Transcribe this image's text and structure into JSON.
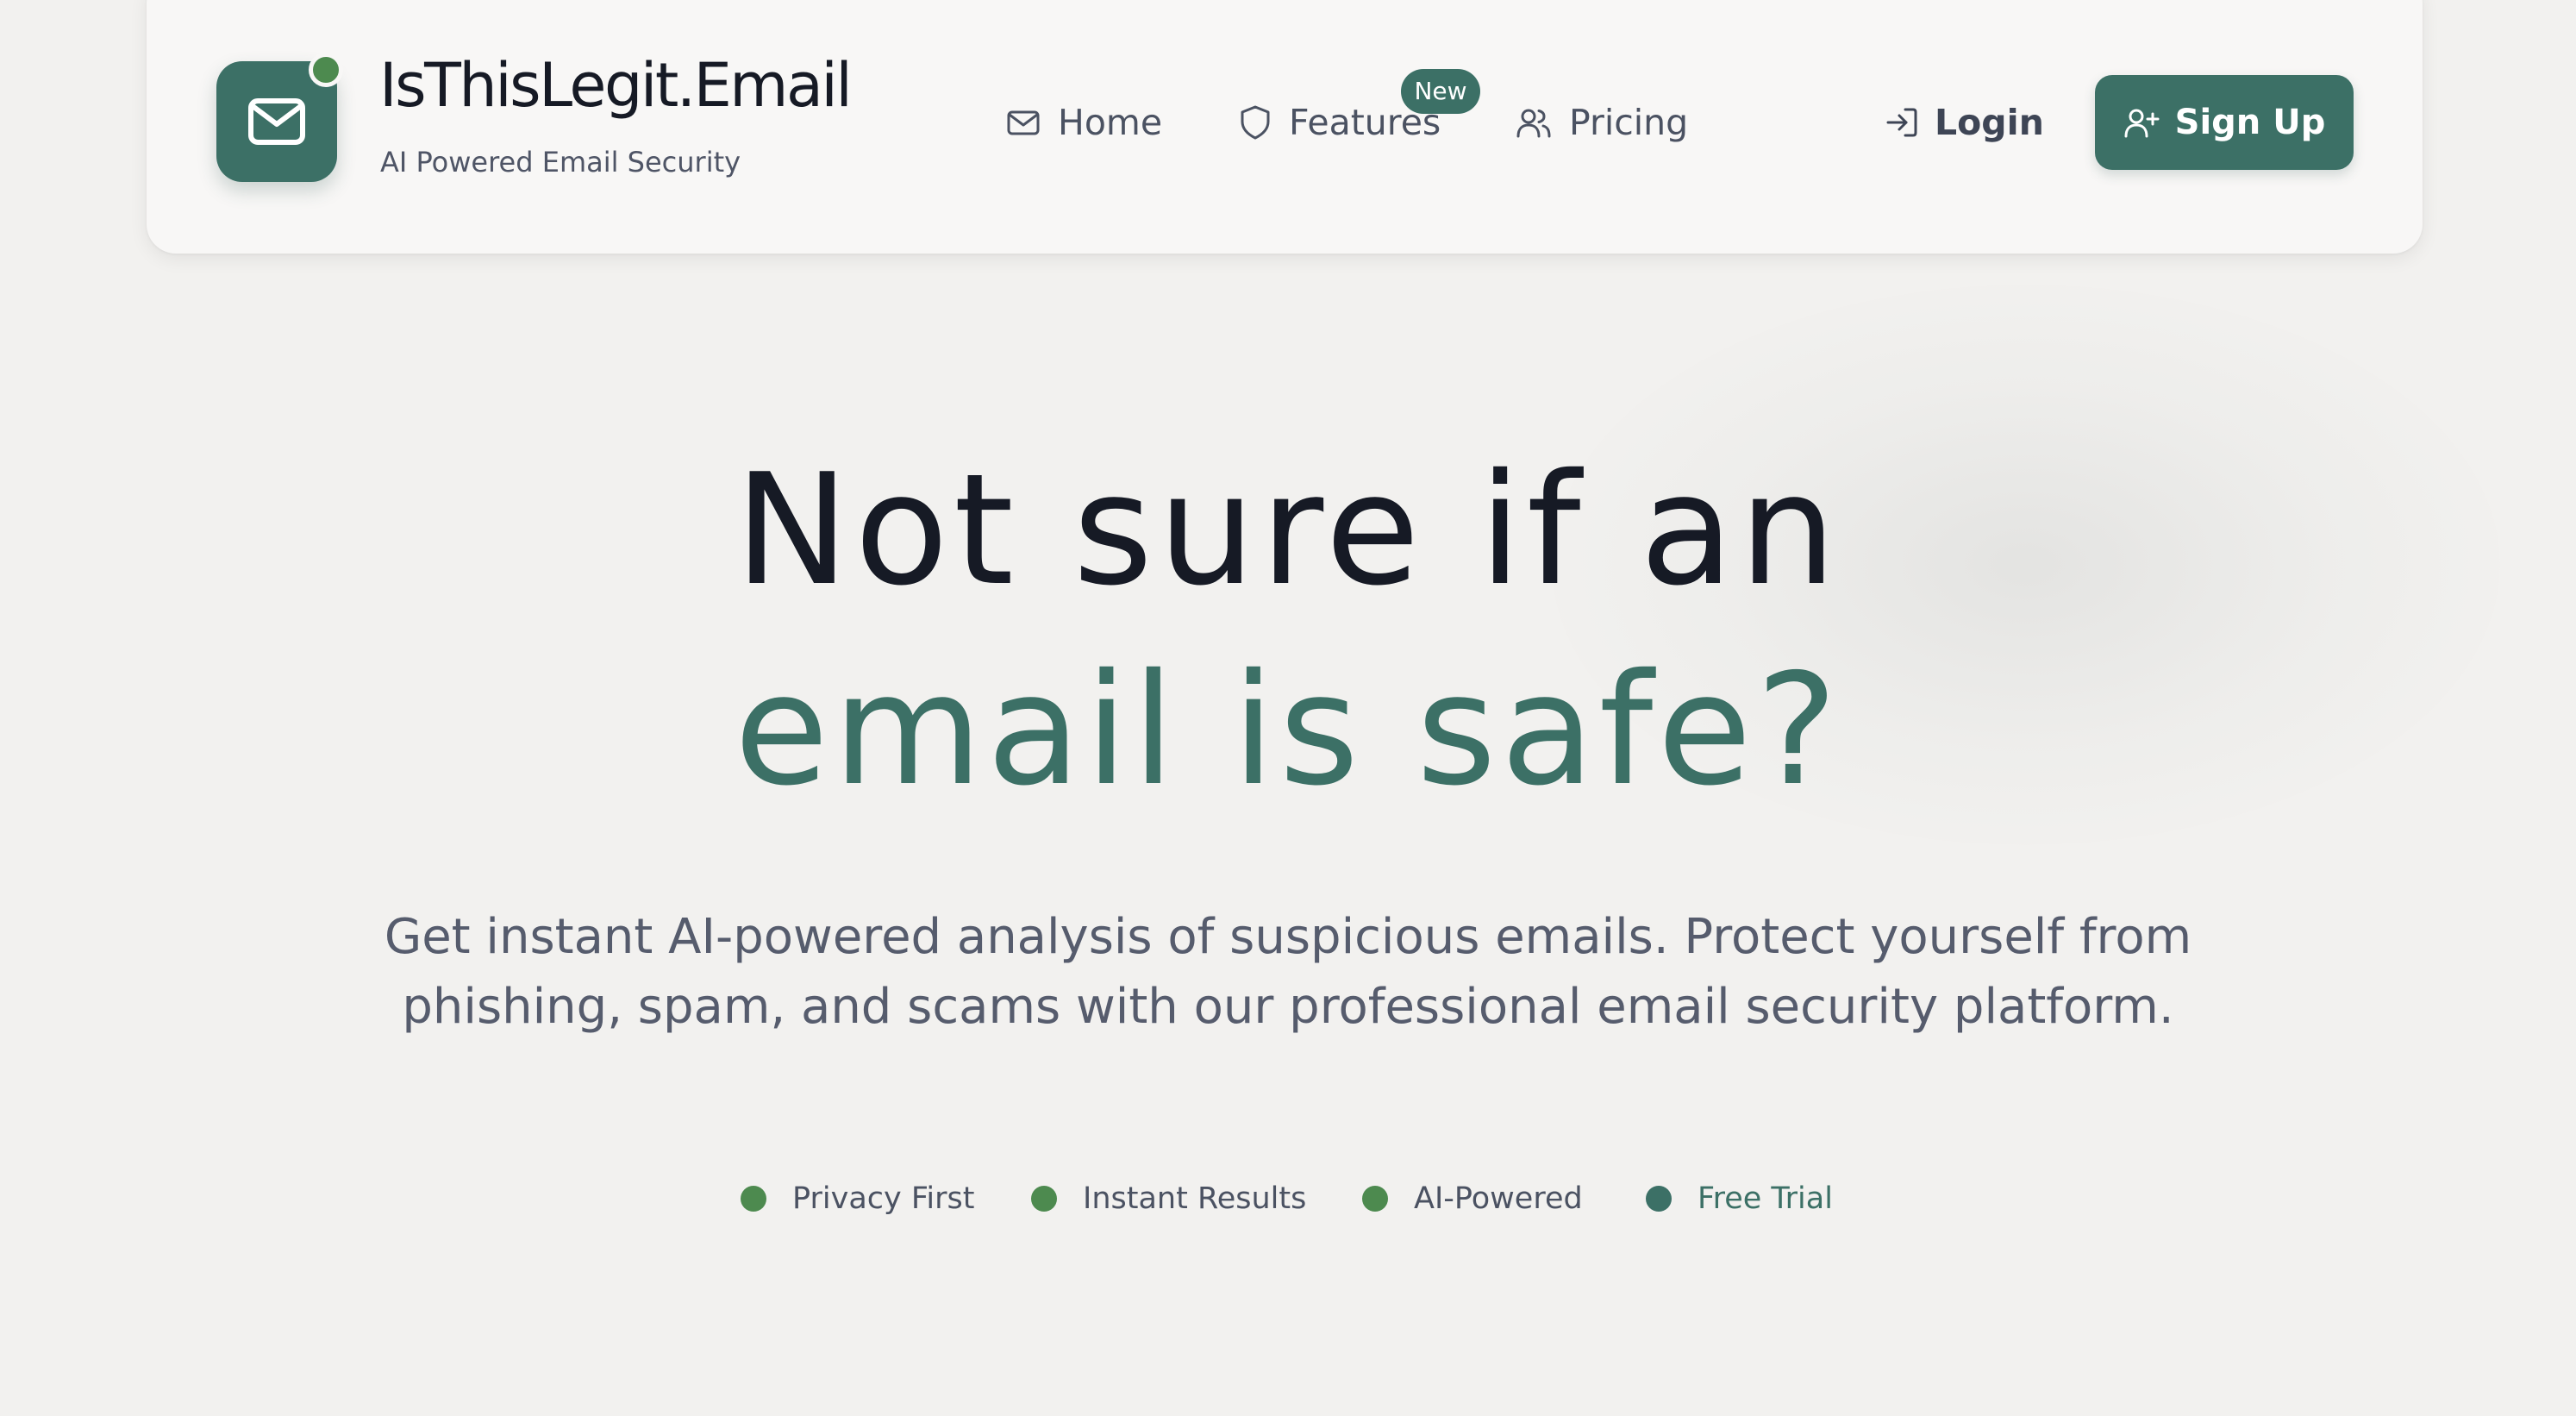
{
  "colors": {
    "accent": "#3c7066",
    "status_green": "#4d8a4f",
    "text_dark": "#161a25",
    "text_muted": "#565c6d",
    "background": "#f2f1ef"
  },
  "brand": {
    "name": "IsThisLegit.Email",
    "tagline": "AI Powered Email Security",
    "logo_icon": "mail-icon"
  },
  "nav": {
    "home": {
      "label": "Home",
      "icon": "mail-icon"
    },
    "features": {
      "label": "Features",
      "icon": "shield-icon",
      "badge": "New"
    },
    "pricing": {
      "label": "Pricing",
      "icon": "users-icon"
    }
  },
  "auth": {
    "login": {
      "label": "Login",
      "icon": "login-icon"
    },
    "signup": {
      "label": "Sign Up",
      "icon": "user-plus-icon"
    }
  },
  "hero": {
    "line1": "Not sure if an",
    "line2": "email is safe?",
    "subtext_line1": "Get instant AI-powered analysis of suspicious emails. Protect yourself from",
    "subtext_line2": "phishing, spam, and scams with our professional email security platform."
  },
  "features": [
    {
      "label": "Privacy First",
      "dot_color": "#4d8a4f"
    },
    {
      "label": "Instant Results",
      "dot_color": "#4d8a4f"
    },
    {
      "label": "AI-Powered",
      "dot_color": "#4d8a4f"
    },
    {
      "label": "Free Trial",
      "dot_color": "#3c7066"
    }
  ]
}
